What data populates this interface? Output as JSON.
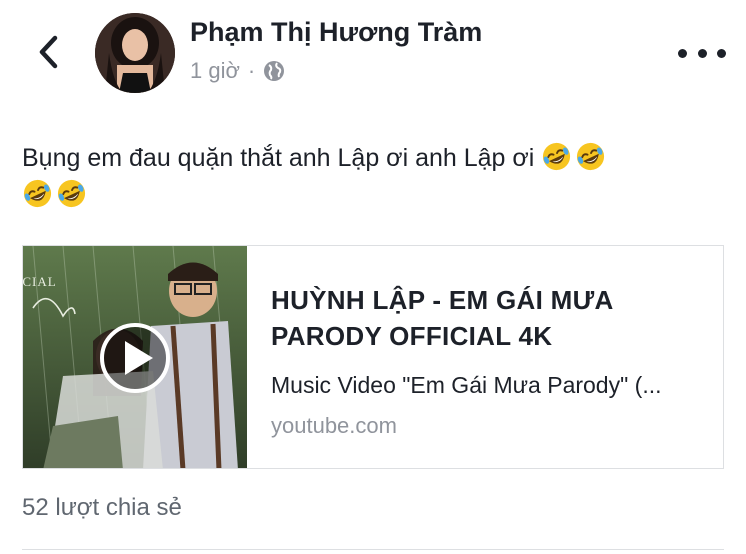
{
  "header": {
    "back_icon": "chevron-left-icon",
    "author_name": "Phạm Thị Hương Tràm",
    "timestamp": "1 giờ",
    "separator": "·",
    "privacy_icon": "globe-icon",
    "more_icon": "more-horizontal-icon"
  },
  "post": {
    "text": "Bụng em đau quặn thắt anh Lập ơi anh Lập ơi",
    "emoji_icon": "rolling-on-floor-laughing-emoji",
    "emoji_count": 4
  },
  "link_card": {
    "title": "HUỲNH LẬP - EM GÁI MƯA PARODY OFFICIAL 4K",
    "description": "Music Video \"Em Gái Mưa Parody\" (...",
    "domain": "youtube.com",
    "play_icon": "play-icon",
    "thumbnail_text": "ICIAL"
  },
  "footer": {
    "shares_text": "52 lượt chia sẻ"
  }
}
